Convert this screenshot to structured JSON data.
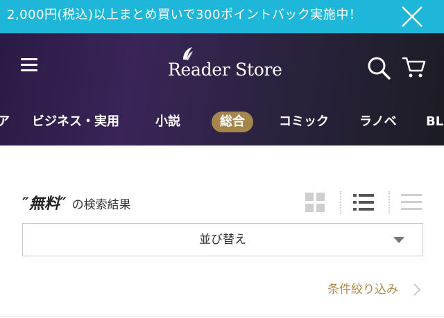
{
  "promo": {
    "text": "2,000円(税込)以上まとめ買いで300ポイントバック実施中！",
    "close_icon": "close-icon",
    "background": "#1fb7d9"
  },
  "header": {
    "logo_text": "Reader Store",
    "menu_icon": "hamburger-menu-icon",
    "search_icon": "search-icon",
    "cart_icon": "cart-icon",
    "categories": [
      {
        "label": "ア"
      },
      {
        "label": "ビジネス・実用"
      },
      {
        "label": "小説"
      },
      {
        "label": "総合",
        "active": true
      },
      {
        "label": "コミック"
      },
      {
        "label": "ラノベ"
      },
      {
        "label": "BL"
      }
    ],
    "accent": "#a6864a"
  },
  "results": {
    "query": "″無料″",
    "query_suffix": "の検索結果",
    "view_modes": [
      "grid-view-icon",
      "list-view-icon",
      "compact-list-view-icon"
    ],
    "sort": {
      "label": "並び替え"
    },
    "filter_label": "条件絞り込み",
    "filter_color": "#b08b4b"
  }
}
